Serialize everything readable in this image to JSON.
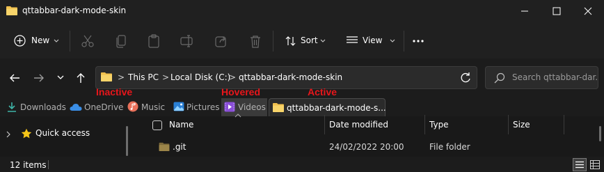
{
  "window": {
    "title": "qttabbar-dark-mode-skin",
    "controls": {
      "minimize_icon": "minimize-icon",
      "maximize_icon": "maximize-icon",
      "close_icon": "close-icon"
    }
  },
  "toolbar": {
    "new_label": "New",
    "sort_label": "Sort",
    "view_label": "View",
    "icons": [
      "cut-icon",
      "copy-icon",
      "paste-icon",
      "rename-icon",
      "share-icon",
      "delete-icon",
      "more-icon"
    ]
  },
  "address": {
    "breadcrumbs": [
      "This PC",
      "Local Disk (C:)",
      "qttabbar-dark-mode-skin"
    ],
    "separator": ">",
    "search_placeholder": "Search qttabbar-dar..."
  },
  "annotations": {
    "inactive": "Inactive",
    "hovered": "Hovered",
    "active": "Active",
    "color": "#e8161b"
  },
  "tabs": [
    {
      "label": "Downloads",
      "icon": "download-icon",
      "state": "inactive"
    },
    {
      "label": "OneDrive",
      "icon": "cloud-icon",
      "state": "inactive"
    },
    {
      "label": "Music",
      "icon": "music-icon",
      "state": "inactive"
    },
    {
      "label": "Pictures",
      "icon": "pictures-icon",
      "state": "inactive"
    },
    {
      "label": "Videos",
      "icon": "videos-icon",
      "state": "hovered"
    },
    {
      "label": "qttabbar-dark-mode-s...",
      "icon": "folder-icon",
      "state": "active"
    }
  ],
  "sidebar": {
    "items": [
      {
        "label": "Quick access",
        "icon": "star-icon"
      }
    ]
  },
  "file_list": {
    "columns": [
      "Name",
      "Date modified",
      "Type",
      "Size"
    ],
    "rows": [
      {
        "name": ".git",
        "date_modified": "24/02/2022 20:00",
        "type": "File folder",
        "size": ""
      }
    ]
  },
  "status": {
    "item_count": "12 items"
  },
  "colors": {
    "accent": "#4cc2ff",
    "folder": "#f2c14e",
    "background": "#1c1c1c",
    "chrome": "#202020"
  }
}
